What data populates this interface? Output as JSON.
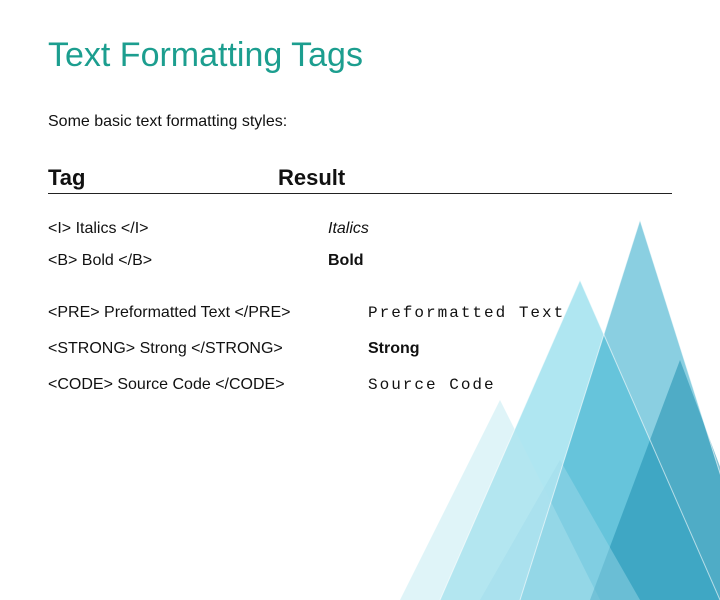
{
  "title": "Text Formatting Tags",
  "subtitle": "Some basic text formatting styles:",
  "headers": {
    "tag": "Tag",
    "result": "Result"
  },
  "group1": [
    {
      "tag": "<I> Italics </I>",
      "result": "Italics",
      "style": "italic"
    },
    {
      "tag": "<B> Bold </B>",
      "result": "Bold",
      "style": "bold"
    }
  ],
  "group2": [
    {
      "tag": "<PRE> Preformatted Text </PRE>",
      "result": "Preformatted Text",
      "style": "mono"
    },
    {
      "tag": "<STRONG> Strong </STRONG>",
      "result": "Strong",
      "style": "bold"
    },
    {
      "tag": "<CODE> Source Code </CODE>",
      "result": "Source Code",
      "style": "mono"
    }
  ]
}
